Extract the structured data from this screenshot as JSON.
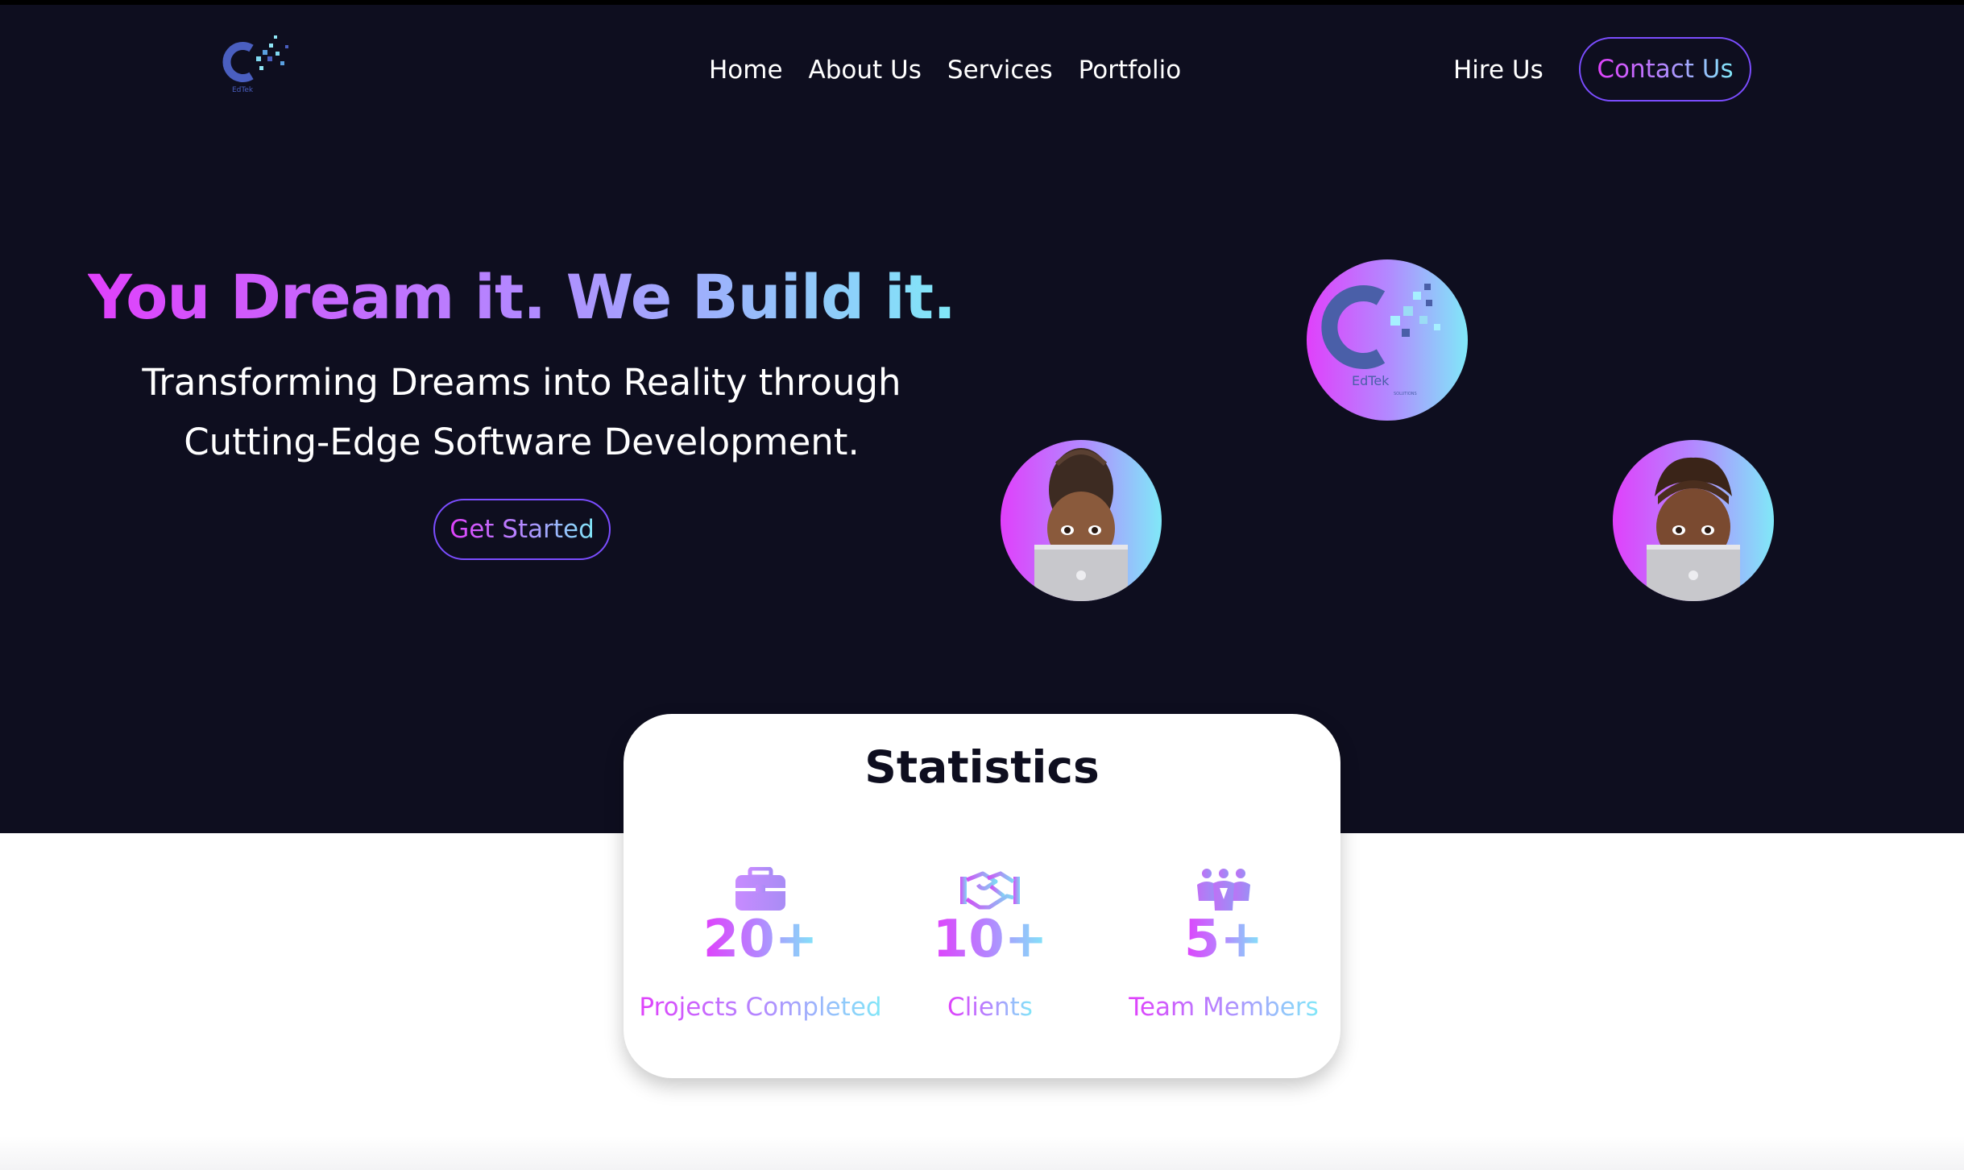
{
  "brand": {
    "logo_icon": "edtek-logo-icon"
  },
  "nav": {
    "links": [
      {
        "label": "Home"
      },
      {
        "label": "About Us"
      },
      {
        "label": "Services"
      },
      {
        "label": "Portfolio"
      }
    ],
    "hire_label": "Hire Us",
    "contact_label": "Contact Us"
  },
  "hero": {
    "title": "You Dream it. We Build it.",
    "subtitle": "Transforming Dreams into Reality through Cutting-Edge Software Development.",
    "cta_label": "Get Started",
    "images": [
      "edtek-logo-circle",
      "developer-avatar-female",
      "developer-avatar-male"
    ]
  },
  "stats": {
    "title": "Statistics",
    "items": [
      {
        "icon": "briefcase-icon",
        "value": "20+",
        "label": "Projects Completed"
      },
      {
        "icon": "handshake-icon",
        "value": "10+",
        "label": "Clients"
      },
      {
        "icon": "team-icon",
        "value": "5+",
        "label": "Team Members"
      }
    ]
  },
  "colors": {
    "background": "#0e0e1f",
    "gradient_start": "#e040fb",
    "gradient_mid": "#b388ff",
    "gradient_end": "#80e8f8",
    "button_border": "#7b4dff"
  }
}
